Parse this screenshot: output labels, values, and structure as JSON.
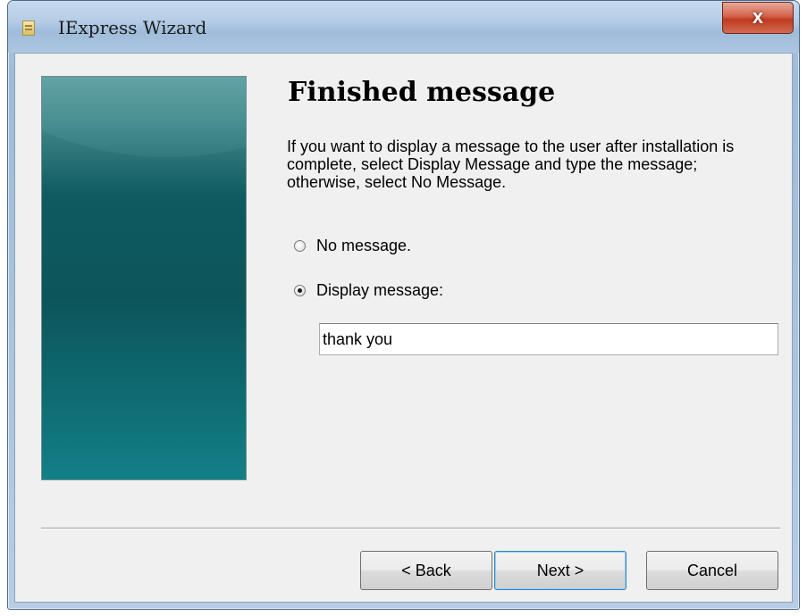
{
  "window": {
    "title": "IExpress Wizard",
    "close_label": "x"
  },
  "page": {
    "heading": "Finished message",
    "description": "If you want to display a message to the user after installation is complete, select Display Message and type the message; otherwise, select No Message."
  },
  "options": {
    "no_message_label": "No message.",
    "display_message_label": "Display message:",
    "selected": "display_message"
  },
  "message_input": {
    "value": "thank you"
  },
  "buttons": {
    "back": "< Back",
    "next": "Next >",
    "cancel": "Cancel"
  }
}
